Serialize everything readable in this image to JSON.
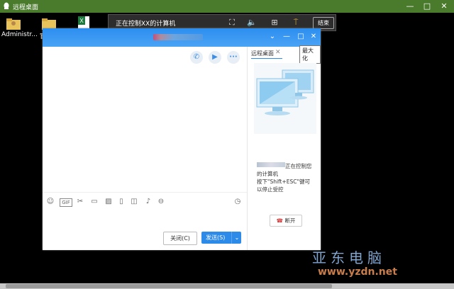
{
  "outer_window": {
    "title": "远程桌面",
    "minimize_glyph": "—",
    "maximize_glyph": "□",
    "close_glyph": "✕",
    "accent": "#4a7a2c"
  },
  "desktop": {
    "icons": [
      {
        "label": "Administr...",
        "icon": "folder-user-icon"
      },
      {
        "label": "官",
        "icon": "folder-icon"
      },
      {
        "label": "",
        "icon": "excel-file-icon"
      }
    ]
  },
  "remote_toolbar": {
    "status": "正在控制XX的计算机",
    "end_button": "结束"
  },
  "chat": {
    "header_color": "#2d8ef0",
    "controls": {
      "dropdown": "⌄",
      "minimize": "—",
      "maximize": "□",
      "close": "✕"
    },
    "tooltip": "最大化",
    "toolbar_icons": [
      "emoji-icon",
      "gif-icon",
      "scissors-icon",
      "folder-icon",
      "image-icon",
      "phone-screen-icon",
      "shake-icon",
      "music-icon",
      "more-icon",
      "history-icon"
    ],
    "close_button": "关闭(C)",
    "send_button": "发送(S)",
    "send_arrow": "⌄"
  },
  "side_panel": {
    "tab_label": "远程桌面",
    "tab_close": "✕",
    "message_line1": "正在控制您",
    "message_line2": "的计算机",
    "message_line3": "按下\"Shift+ESC\"键可",
    "message_line4": "以停止受控",
    "disconnect_button": "断开"
  },
  "watermark": {
    "chinese": "亚东电脑",
    "url": "www.yzdn.net"
  }
}
